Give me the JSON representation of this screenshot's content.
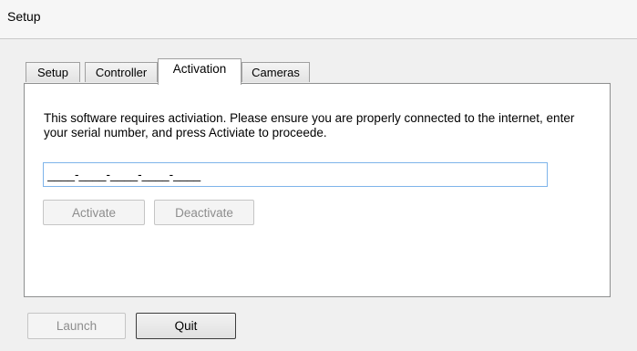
{
  "window": {
    "title": "Setup"
  },
  "tabs": [
    {
      "label": "Setup"
    },
    {
      "label": "Controller"
    },
    {
      "label": "Activation"
    },
    {
      "label": "Cameras"
    }
  ],
  "activation": {
    "instructions": "This software requires activiation. Please ensure you are properly connected to the internet, enter your serial number, and press Activiate to proceede.",
    "serial_value": "____-____-____-____-____",
    "activate_label": "Activate",
    "deactivate_label": "Deactivate"
  },
  "footer": {
    "launch_label": "Launch",
    "quit_label": "Quit"
  }
}
